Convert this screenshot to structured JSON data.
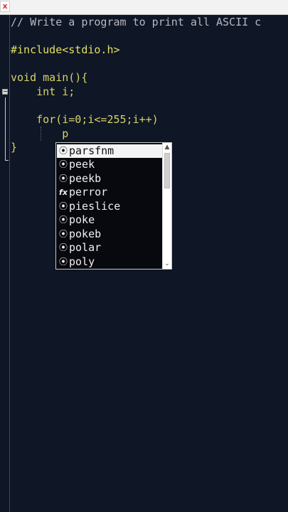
{
  "window": {
    "close_glyph": "x"
  },
  "editor": {
    "lines": [
      {
        "text": "// Write a program to print all ASCII c"
      },
      {
        "text": ""
      },
      {
        "text": "#include<stdio.h>"
      },
      {
        "text": ""
      },
      {
        "text": "void main(){"
      },
      {
        "text": "    int i;"
      },
      {
        "text": ""
      },
      {
        "text": "    for(i=0;i<=255;i++)"
      },
      {
        "text": "        p"
      },
      {
        "text": "}"
      }
    ],
    "fold_marker": "−"
  },
  "autocomplete": {
    "items": [
      {
        "label": "parsfnm",
        "icon": "function-icon",
        "glyph": "⦿",
        "selected": true
      },
      {
        "label": "peek",
        "icon": "function-icon",
        "glyph": "⦿"
      },
      {
        "label": "peekb",
        "icon": "function-icon",
        "glyph": "⦿"
      },
      {
        "label": "perror",
        "icon": "fx-icon",
        "glyph": "fx"
      },
      {
        "label": "pieslice",
        "icon": "function-icon",
        "glyph": "⦿"
      },
      {
        "label": "poke",
        "icon": "function-icon",
        "glyph": "⦿"
      },
      {
        "label": "pokeb",
        "icon": "function-icon",
        "glyph": "⦿"
      },
      {
        "label": "polar",
        "icon": "function-icon",
        "glyph": "⦿"
      },
      {
        "label": "poly",
        "icon": "function-icon",
        "glyph": "⦿"
      }
    ],
    "scroll_up_glyph": "▲",
    "scroll_down_glyph": "⌄"
  },
  "colors": {
    "background": "#0f1626",
    "comment": "#b8b8c0",
    "keyword": "#d4d46a",
    "text": "#e6e6e6"
  }
}
